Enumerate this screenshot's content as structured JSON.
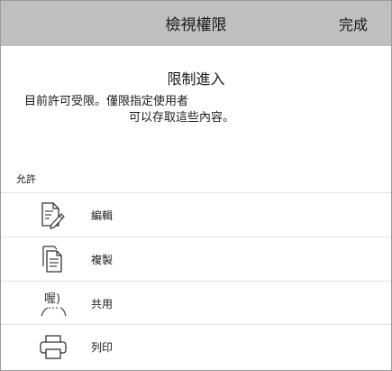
{
  "header": {
    "title": "檢視權限",
    "done_label": "完成"
  },
  "restriction": {
    "title": "限制進入",
    "description_line1": "目前許可受限。僅限指定使用者",
    "description_line2": "可以存取這些內容。"
  },
  "permissions": {
    "section_label": "允許",
    "items": [
      {
        "label": "編輯",
        "icon": "edit-document-icon"
      },
      {
        "label": "複製",
        "icon": "copy-document-icon"
      },
      {
        "label": "共用",
        "icon": "share-icon",
        "icon_text": "喔)"
      },
      {
        "label": "列印",
        "icon": "printer-icon"
      }
    ]
  },
  "colors": {
    "header_background": "#bfbfbf",
    "divider": "#e3e3e3",
    "text": "#1a1a1a"
  }
}
